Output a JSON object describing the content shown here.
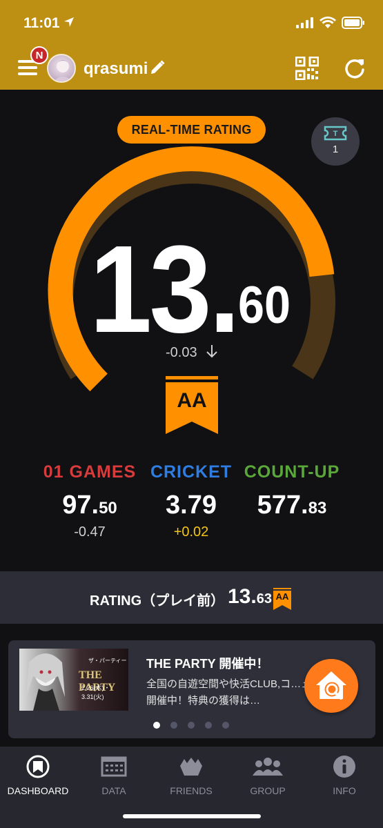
{
  "status_bar": {
    "time": "11:01"
  },
  "header": {
    "menu_badge": "N",
    "username": "qrasumi"
  },
  "dashboard": {
    "realtime_label": "REAL-TIME RATING",
    "ticket_count": "1",
    "rating_integer": "13.",
    "rating_decimal": "60",
    "rating_change": "-0.03",
    "grade": "AA",
    "gauge_fill_fraction": 0.81,
    "stats": [
      {
        "label": "01 GAMES",
        "value_int": "97.",
        "value_dec": "50",
        "change": "-0.47",
        "label_color": "#d83b3b",
        "change_color": "#cfcfcf"
      },
      {
        "label": "CRICKET",
        "value_int": "3.79",
        "value_dec": "",
        "change": "+0.02",
        "label_color": "#2f7de0",
        "change_color": "#f5c518"
      },
      {
        "label": "COUNT-UP",
        "value_int": "577.",
        "value_dec": "83",
        "change": "",
        "label_color": "#5aa83a",
        "change_color": "#cfcfcf"
      }
    ]
  },
  "previous_rating": {
    "label": "RATING（プレイ前）",
    "value_int": "13.",
    "value_dec": "63",
    "grade": "AA"
  },
  "news": {
    "thumb_title": "THE PARTY",
    "thumb_sub": "ザ・パーティー",
    "thumb_dates": "2.26(木)・3.31(火)",
    "title": "THE PARTY 開催中！",
    "body": "全国の自遊空間や快活CLUB,コ…ュールにて開催中！特典の獲得は…",
    "page_count": 5,
    "active_page": 0
  },
  "tabs": [
    {
      "label": "DASHBOARD",
      "icon": "dashboard-icon",
      "active": true
    },
    {
      "label": "DATA",
      "icon": "data-icon",
      "active": false
    },
    {
      "label": "FRIENDS",
      "icon": "friends-icon",
      "active": false
    },
    {
      "label": "GROUP",
      "icon": "group-icon",
      "active": false
    },
    {
      "label": "INFO",
      "icon": "info-icon",
      "active": false
    }
  ],
  "colors": {
    "header_bg": "#bd8f12",
    "accent_orange": "#ff9100",
    "gauge_track": "#4a3518",
    "background": "#111114"
  }
}
